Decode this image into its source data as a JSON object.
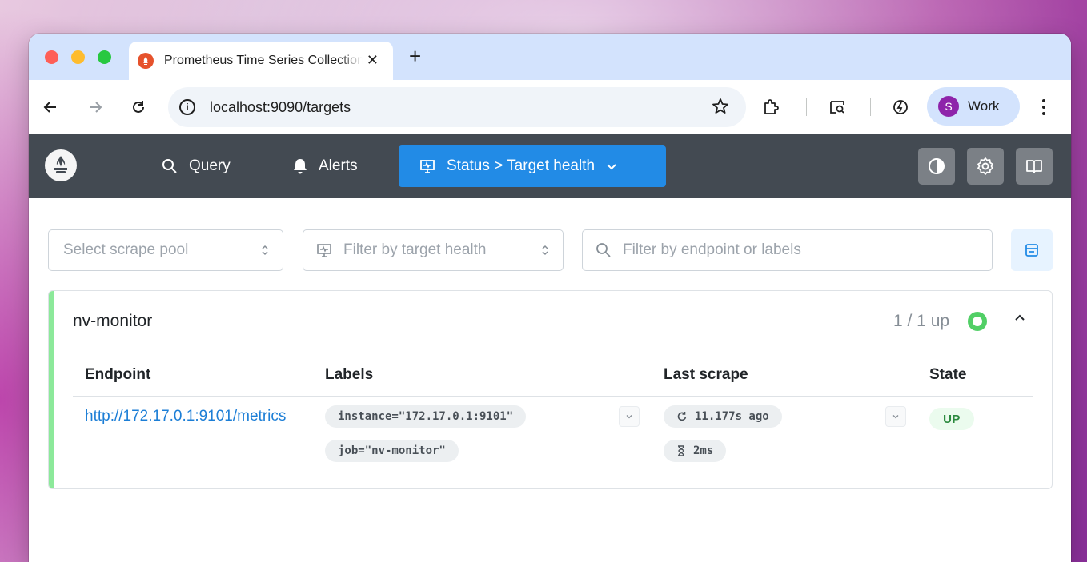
{
  "browser": {
    "tab_title": "Prometheus Time Series Collection and Processing Server",
    "tab_close": "✕",
    "new_tab": "+",
    "url": "localhost:9090/targets",
    "profile_initial": "S",
    "profile_name": "Work"
  },
  "navbar": {
    "items": [
      {
        "label": "Query",
        "icon": "search-icon"
      },
      {
        "label": "Alerts",
        "icon": "bell-icon"
      }
    ],
    "active": {
      "label": "Status > Target health",
      "icon": "monitor-icon"
    },
    "actions": [
      "theme-toggle-icon",
      "settings-icon",
      "docs-book-icon"
    ]
  },
  "filters": {
    "scrape_pool_placeholder": "Select scrape pool",
    "health_placeholder": "Filter by target health",
    "search_placeholder": "Filter by endpoint or labels"
  },
  "pool": {
    "name": "nv-monitor",
    "up_count": "1 / 1 up",
    "status_color": "#51cf66",
    "columns": [
      "Endpoint",
      "Labels",
      "Last scrape",
      "State"
    ],
    "rows": [
      {
        "endpoint": "http://172.17.0.1:9101/metrics",
        "labels": [
          "instance=\"172.17.0.1:9101\"",
          "job=\"nv-monitor\""
        ],
        "last_scrape": "11.177s ago",
        "scrape_duration": "2ms",
        "state": "UP"
      }
    ]
  },
  "colors": {
    "accent": "#228be6",
    "navbar_bg": "#434a52",
    "link": "#1c7ed6",
    "healthy": "#8ce99a"
  }
}
